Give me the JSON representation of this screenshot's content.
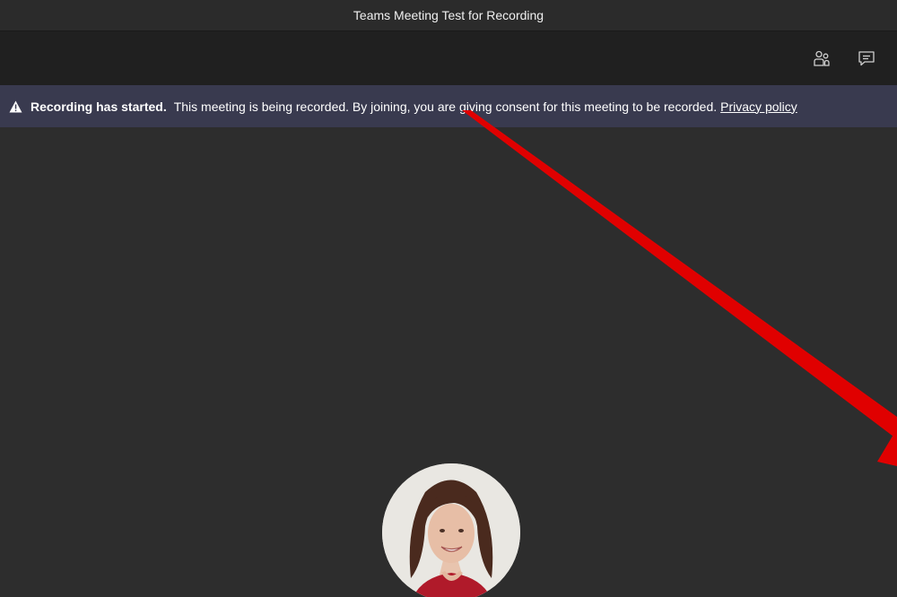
{
  "window": {
    "title": "Teams Meeting Test for Recording"
  },
  "toolbar": {
    "buttons": [
      {
        "icon": "participants-icon",
        "label": "Show participants"
      },
      {
        "icon": "chat-icon",
        "label": "Show conversation"
      }
    ]
  },
  "banner": {
    "heading": "Recording has started.",
    "message": "This meeting is being recorded. By joining, you are giving consent for this meeting to be recorded.",
    "link_text": "Privacy policy",
    "icon": "warning-icon",
    "background_color": "#393a4f"
  },
  "participant": {
    "avatar_icon": "user-avatar"
  },
  "annotation": {
    "arrow_color": "#e00000"
  },
  "colors": {
    "stage_background": "#2d2d2d",
    "toolbar_background": "#202020",
    "text": "#ffffff"
  }
}
